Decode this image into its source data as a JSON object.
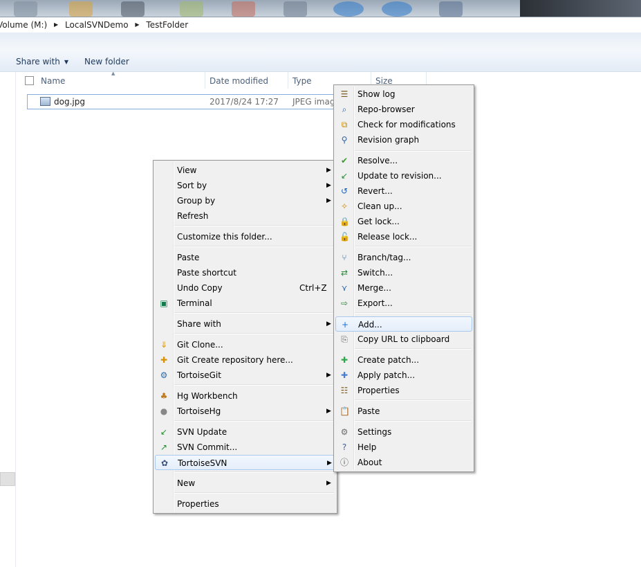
{
  "explorer": {
    "breadcrumb": [
      "Volume (M:)",
      "LocalSVNDemo",
      "TestFolder"
    ],
    "commands": {
      "share_with": "Share with",
      "new_folder": "New folder"
    },
    "columns": {
      "name": "Name",
      "date_modified": "Date modified",
      "type": "Type",
      "size": "Size"
    },
    "files": [
      {
        "name": "dog.jpg",
        "date_modified": "2017/8/24 17:27",
        "type": "JPEG image"
      }
    ]
  },
  "context_menu": {
    "items": [
      {
        "label": "View",
        "submenu": true
      },
      {
        "label": "Sort by",
        "submenu": true
      },
      {
        "label": "Group by",
        "submenu": true
      },
      {
        "label": "Refresh"
      },
      {
        "label": "Customize this folder..."
      },
      {
        "label": "Paste"
      },
      {
        "label": "Paste shortcut"
      },
      {
        "label": "Undo Copy",
        "shortcut": "Ctrl+Z"
      },
      {
        "label": "Terminal",
        "icon": "terminal-icon"
      },
      {
        "label": "Share with",
        "submenu": true
      },
      {
        "label": "Git Clone...",
        "icon": "git-clone-icon"
      },
      {
        "label": "Git Create repository here...",
        "icon": "git-create-repo-icon"
      },
      {
        "label": "TortoiseGit",
        "icon": "tortoisegit-icon",
        "submenu": true
      },
      {
        "label": "Hg Workbench",
        "icon": "hg-workbench-icon"
      },
      {
        "label": "TortoiseHg",
        "icon": "tortoisehg-icon",
        "submenu": true
      },
      {
        "label": "SVN Update",
        "icon": "svn-update-icon"
      },
      {
        "label": "SVN Commit...",
        "icon": "svn-commit-icon"
      },
      {
        "label": "TortoiseSVN",
        "icon": "tortoisesvn-icon",
        "submenu": true,
        "highlighted": true
      },
      {
        "label": "New",
        "submenu": true
      },
      {
        "label": "Properties"
      }
    ]
  },
  "svn_submenu": {
    "items": [
      {
        "label": "Show log",
        "icon": "show-log-icon"
      },
      {
        "label": "Repo-browser",
        "icon": "repo-browser-icon"
      },
      {
        "label": "Check for modifications",
        "icon": "check-modifications-icon"
      },
      {
        "label": "Revision graph",
        "icon": "revision-graph-icon"
      },
      {
        "label": "Resolve...",
        "icon": "resolve-icon"
      },
      {
        "label": "Update to revision...",
        "icon": "update-revision-icon"
      },
      {
        "label": "Revert...",
        "icon": "revert-icon"
      },
      {
        "label": "Clean up...",
        "icon": "cleanup-icon"
      },
      {
        "label": "Get lock...",
        "icon": "lock-icon"
      },
      {
        "label": "Release lock...",
        "icon": "unlock-icon"
      },
      {
        "label": "Branch/tag...",
        "icon": "branch-icon"
      },
      {
        "label": "Switch...",
        "icon": "switch-icon"
      },
      {
        "label": "Merge...",
        "icon": "merge-icon"
      },
      {
        "label": "Export...",
        "icon": "export-icon"
      },
      {
        "label": "Add...",
        "icon": "add-icon",
        "highlighted": true
      },
      {
        "label": "Copy URL to clipboard",
        "icon": "copy-url-icon"
      },
      {
        "label": "Create patch...",
        "icon": "create-patch-icon"
      },
      {
        "label": "Apply patch...",
        "icon": "apply-patch-icon"
      },
      {
        "label": "Properties",
        "icon": "properties-icon"
      },
      {
        "label": "Paste",
        "icon": "paste-icon"
      },
      {
        "label": "Settings",
        "icon": "settings-icon"
      },
      {
        "label": "Help",
        "icon": "help-icon"
      },
      {
        "label": "About",
        "icon": "about-icon"
      }
    ]
  },
  "colors": {
    "accent": "#a8c8ee",
    "menu_bg": "#f0f0f0",
    "header_text": "#4c607a"
  }
}
